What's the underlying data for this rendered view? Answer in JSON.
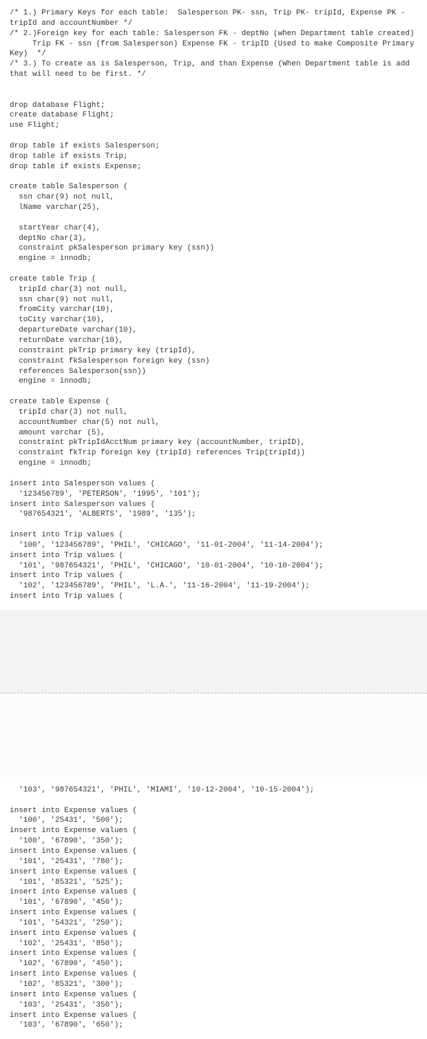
{
  "page1": "/* 1.) Primary Keys for each table:  Salesperson PK- ssn, Trip PK- tripId, Expense PK - tripId and accountNumber */\n/* 2.)Foreign key for each table: Salesperson FK - deptNo (when Department table created)\n     Trip FK - ssn (from Salesperson) Expense FK - tripID (Used to make Composite Primary Key)  */\n/* 3.) To create as is Salesperson, Trip, and than Expense (When Department table is add that will need to be first. */\n\n\ndrop database Flight;\ncreate database Flight;\nuse Flight;\n\ndrop table if exists Salesperson;\ndrop table if exists Trip;\ndrop table if exists Expense;\n\ncreate table Salesperson (\n  ssn char(9) not null,\n  lName varchar(25),\n\n  startYear char(4),\n  deptNo char(3),\n  constraint pkSalesperson primary key (ssn))\n  engine = innodb;\n\ncreate table Trip (\n  tripId char(3) not null,\n  ssn char(9) not null,\n  fromCity varchar(10),\n  toCity varchar(10),\n  departureDate varchar(10),\n  returnDate varchar(10),\n  constraint pkTrip primary key (tripId),\n  constraint fkSalesperson foreign key (ssn)\n  references Salesperson(ssn))\n  engine = innodb;\n\ncreate table Expense (\n  tripId char(3) not null,\n  accountNumber char(5) not null,\n  amount varchar (5),\n  constraint pkTripIdAcctNum primary key (accountNumber, tripID),\n  constraint fkTrip foreign key (tripId) references Trip(tripId))\n  engine = innodb;\n\ninsert into Salesperson values (\n  '123456789', 'PETERSON', '1995', '101');\ninsert into Salesperson values (\n  '987654321', 'ALBERTS', '1989', '135');\n\ninsert into Trip values (\n  '100', '123456789', 'PHIL', 'CHICAGO', '11-01-2004', '11-14-2004');\ninsert into Trip values (\n  '101', '987654321', 'PHIL', 'CHICAGO', '10-01-2004', '10-10-2004');\ninsert into Trip values (\n  '102', '123456789', 'PHIL', 'L.A.', '11-16-2004', '11-19-2004');\ninsert into Trip values (",
  "page2": "  '103', '987654321', 'PHIL', 'MIAMI', '10-12-2004', '10-15-2004');\n\ninsert into Expense values (\n  '100', '25431', '500');\ninsert into Expense values (\n  '100', '67890', '350');\ninsert into Expense values (\n  '101', '25431', '780');\ninsert into Expense values (\n  '101', '85321', '525');\ninsert into Expense values (\n  '101', '67890', '450');\ninsert into Expense values (\n  '101', '54321', '250');\ninsert into Expense values (\n  '102', '25431', '850');\ninsert into Expense values (\n  '102', '67890', '450');\ninsert into Expense values (\n  '102', '85321', '300');\ninsert into Expense values (\n  '103', '25431', '350');\ninsert into Expense values (\n  '103', '67890', '650');"
}
